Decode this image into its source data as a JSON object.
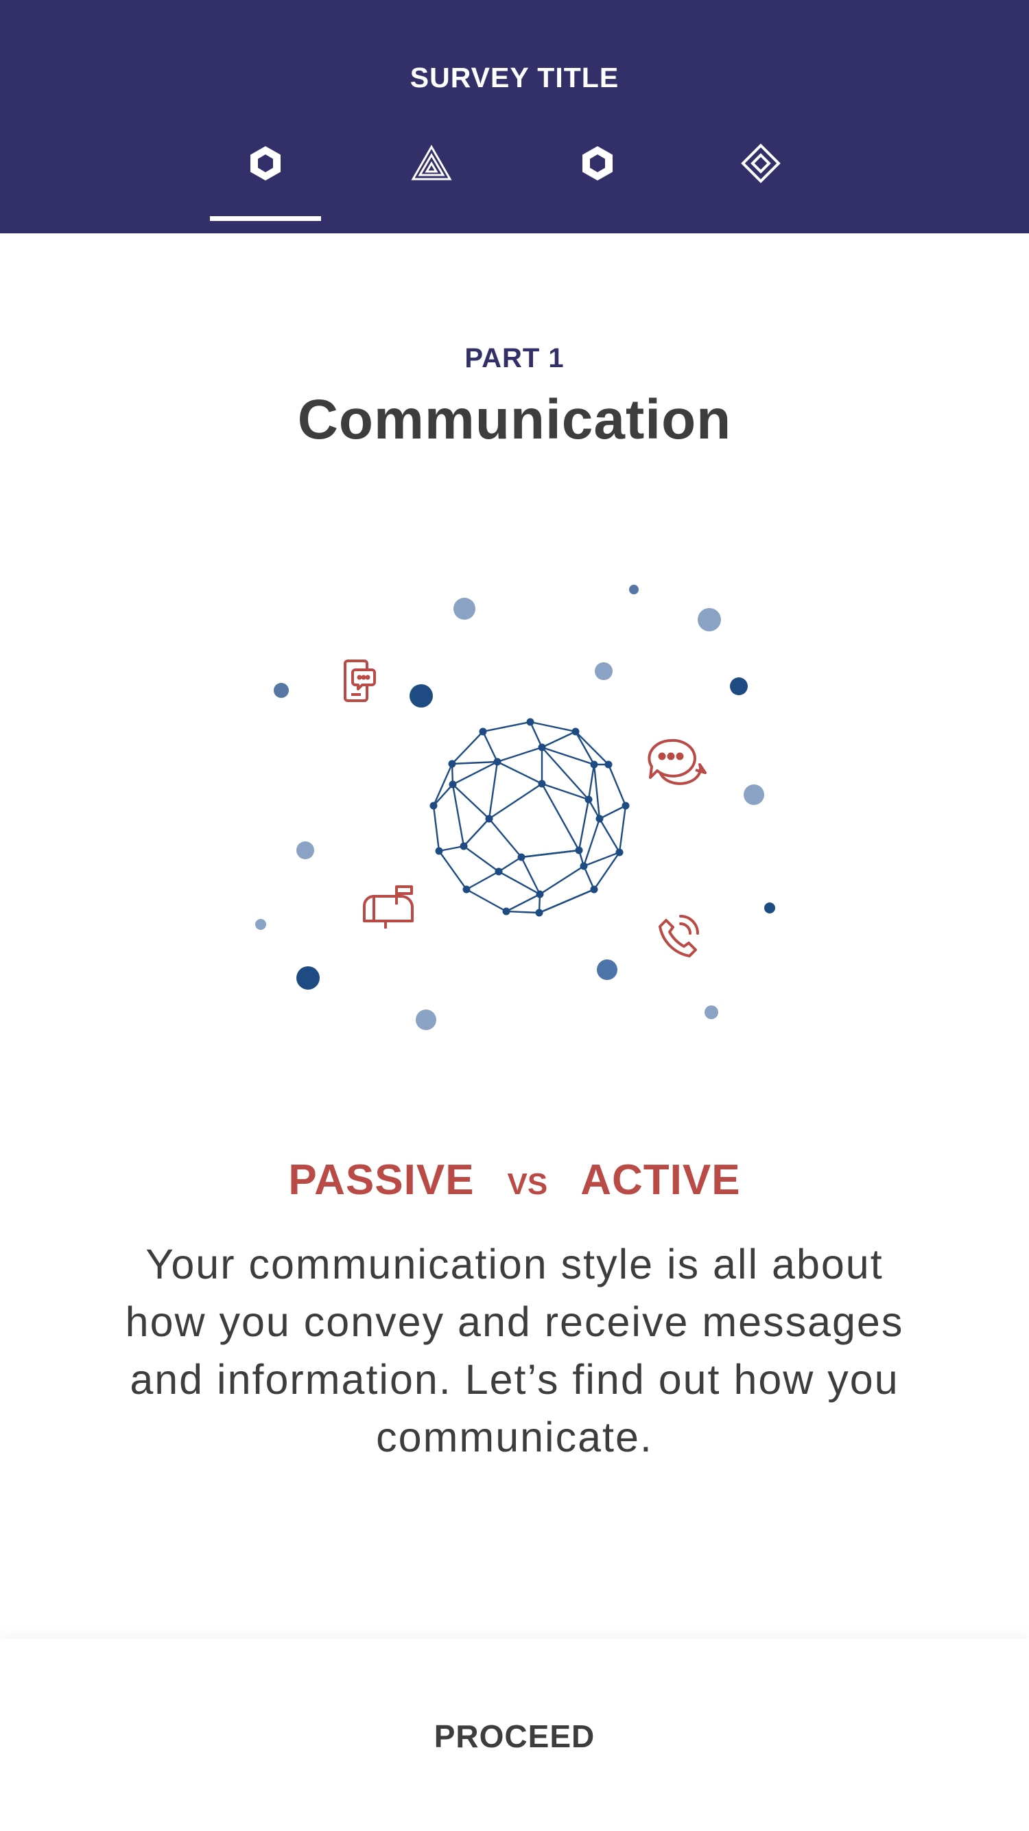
{
  "header": {
    "title": "SURVEY TITLE",
    "tabs": [
      {
        "icon": "hexagon-icon",
        "active": true
      },
      {
        "icon": "triangle-icon",
        "active": false
      },
      {
        "icon": "hexagon-icon",
        "active": false
      },
      {
        "icon": "diamond-icon",
        "active": false
      }
    ]
  },
  "section": {
    "part_label": "PART 1",
    "title": "Communication"
  },
  "illustration": {
    "center_icon": "network-globe-icon",
    "icons": [
      "mobile-chat-icon",
      "speech-bubbles-icon",
      "mailbox-icon",
      "phone-icon"
    ]
  },
  "versus": {
    "left": "PASSIVE",
    "middle": "VS",
    "right": "ACTIVE"
  },
  "description": "Your communication style is all about how you convey and receive messages and information. Let’s find out how you communicate.",
  "footer": {
    "proceed_label": "PROCEED"
  },
  "colors": {
    "header_bg": "#322f69",
    "accent_red": "#b94a45",
    "globe_blue": "#1d4b82",
    "dot_light": "#8aa3c4",
    "text_dark": "#3d3d3d"
  }
}
